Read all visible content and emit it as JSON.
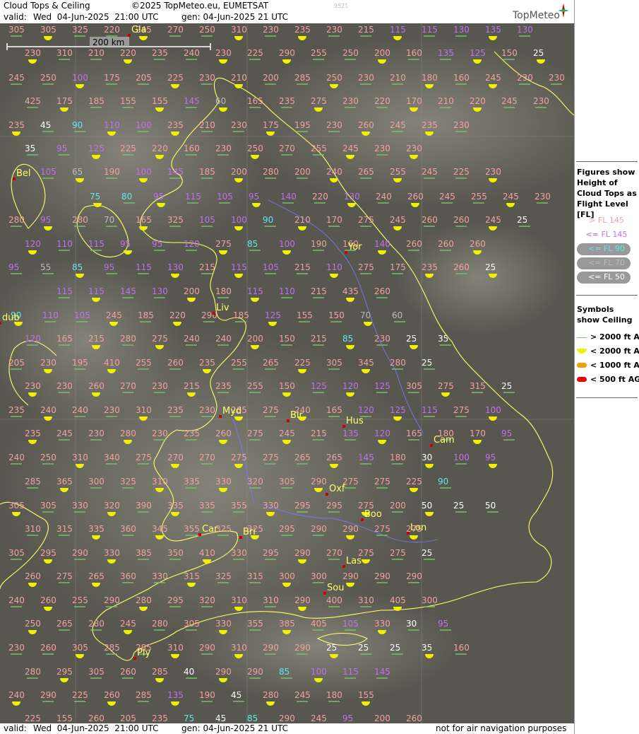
{
  "header": {
    "title": "Cloud Tops & Ceiling",
    "copyright": "©2025 TopMeteo.eu, EUMETSAT",
    "code": "9521",
    "valid_label": "valid:",
    "valid_value": "Wed  04-Jun-2025  21:00 UTC",
    "gen": "gen: 04-Jun-2025 21 UTC",
    "logo": "TopMeteo"
  },
  "footer": {
    "valid_label": "valid:",
    "valid_value": "Wed  04-Jun-2025  21:00 UTC",
    "gen": "gen: 04-Jun-2025 21 UTC",
    "disclaimer": "not for air navigation purposes"
  },
  "scale_bar": {
    "label": "200 km"
  },
  "legend": {
    "figures_title": "Figures show Height of Cloud Tops as Flight Level  [FL]",
    "fl_items": [
      {
        "label": "> FL 145",
        "color": "#f4a0a0"
      },
      {
        "label": "<= FL 145",
        "color": "#c070f0"
      },
      {
        "label": "<= FL 90",
        "color": "#60e8e8"
      },
      {
        "label": "<= FL 70",
        "color": "#bbbbbb"
      },
      {
        "label": "<= FL 50",
        "color": "#ffffff"
      }
    ],
    "symbols_title": "Symbols show Ceiling",
    "symbol_items": [
      {
        "label": "> 2000 ft AGL",
        "kind": "line",
        "color": "#7ac46e"
      },
      {
        "label": "< 2000 ft AGL",
        "kind": "half",
        "color": "#f0f000"
      },
      {
        "label": "< 1000 ft AGL",
        "kind": "bar",
        "color": "#f0a000"
      },
      {
        "label": "< 500 ft AGL",
        "kind": "bar",
        "color": "#ee0000"
      }
    ]
  },
  "colors": {
    "coast": "#ffff66",
    "rivers": "#7777ff",
    "grid": "#888888"
  },
  "cities": [
    {
      "name": "Gla"
    },
    {
      "name": "Bel"
    },
    {
      "name": "Yor"
    },
    {
      "name": "Liv"
    },
    {
      "name": "Myd"
    },
    {
      "name": "Bir"
    },
    {
      "name": "Hus"
    },
    {
      "name": "Cam"
    },
    {
      "name": "Oxf"
    },
    {
      "name": "Boo"
    },
    {
      "name": "Lon"
    },
    {
      "name": "Car"
    },
    {
      "name": "Bri"
    },
    {
      "name": "Las"
    },
    {
      "name": "Sou"
    },
    {
      "name": "Ply"
    },
    {
      "name": "dub"
    }
  ],
  "grid_rows": [
    "305 305 325 220 245 270 250 310 230 235 230 215 115 115 130 135 130",
    "230 310 210 220 235 240 230 225 290 255 250 200 160 135 125 150 25",
    "245 250 100 175 205 225 230 210 200 285 250 230 210 180 160 245 230 230",
    "425 175 185 155 155 145 60 165 235 275 230 220 170 210 220 245 230",
    "235 45 90 110 100 235 210 230 175 195 230 260 245 235 230",
    "35 95 125 225 220 160 230 250 270 255 245 230 230",
    "105 65 190 100 145 185 200 280 200 240 265 255 245 225 230",
    "75 80 95 115 105 95 140 220 130 240 260 245 255 245 230",
    "280 95 280 70 165 325 105 100 90 210 170 275 245 260 260 245 25",
    "120 110 115 95 95 120 275 85 100 190 160 140 260 260 260",
    "95 55 85 95 115 130 215 115 105 215 110 275 175 235 260 25",
    "115 115 145 130 200 180 115 110 215 435 260",
    "90 110 105 245 185 220 290 185 125 155 150 70 60",
    "120 165 215 280 275 240 240 200 150 215 85 230 25 35",
    "205 230 195 410 255 260 235 255 265 225 305 345 280 25",
    "230 230 260 270 230 215 235 255 150 125 120 125 305 275 315 25",
    "235 240 240 230 310 235 230 265 275 240 165 120 125 115 275 100",
    "235 245 230 280 230 235 260 275 245 215 135 120 165 180 170 95",
    "240 250 310 340 275 270 270 275 275 265 265 145 180 30 100 95",
    "285 365 300 325 310 335 330 320 305 290 275 275 225 90",
    "305 305 330 320 390 335 335 355 330 295 295 275 200 50 25 50",
    "310 315 335 360 345 355 325 325 295 290 290 275 275",
    "305 295 290 330 385 350 410 330 295 290 270 275 275 25",
    "260 275 265 360 330 315 325 315 300 300 290 290 290",
    "240 260 255 290 280 295 320 310 310 290 400 310 405 300",
    "250 265 280 245 280 305 330 355 385 405 105 330 30 95",
    "230 260 305 285 285 310 290 310 290 290 25 25 25 35 160",
    "280 295 305 260 285 40 290 290 85 100 115 145",
    "240 290 225 260 285 135 190 45 280 245 180 155",
    "225 155 260 205 235 75 45 85 290 245 95 200 260"
  ]
}
